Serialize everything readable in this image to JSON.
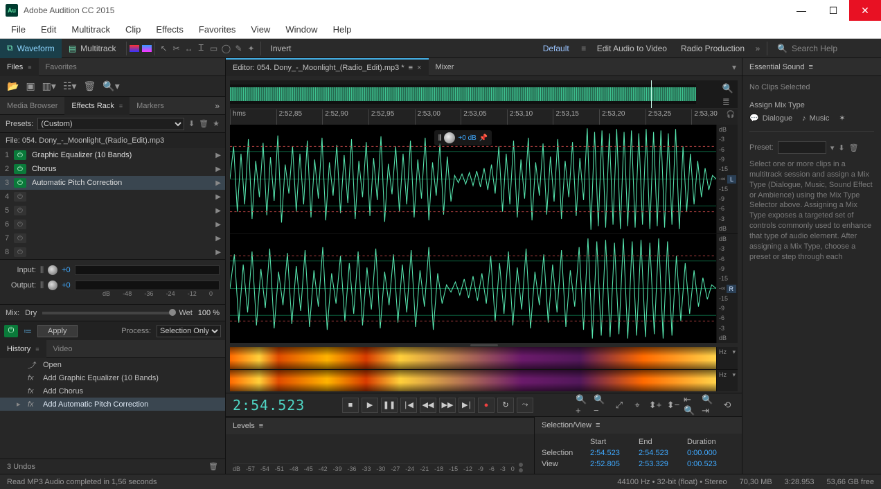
{
  "app": {
    "title": "Adobe Audition CC 2015",
    "icon_text": "Au"
  },
  "menu": [
    "File",
    "Edit",
    "Multitrack",
    "Clip",
    "Effects",
    "Favorites",
    "View",
    "Window",
    "Help"
  ],
  "toolbar": {
    "waveform": "Waveform",
    "multitrack": "Multitrack",
    "invert": "Invert",
    "workspace_default": "Default",
    "ws_edit_av": "Edit Audio to Video",
    "ws_radio": "Radio Production",
    "search_placeholder": "Search Help"
  },
  "left": {
    "tabs_files": "Files",
    "tabs_fav": "Favorites",
    "tabs_mb": "Media Browser",
    "tabs_fx": "Effects Rack",
    "tabs_markers": "Markers",
    "presets_label": "Presets:",
    "presets_value": "(Custom)",
    "file_label": "File: 054. Dony_-_Moonlight_(Radio_Edit).mp3",
    "fx": [
      {
        "n": "1",
        "on": true,
        "name": "Graphic Equalizer (10 Bands)"
      },
      {
        "n": "2",
        "on": true,
        "name": "Chorus"
      },
      {
        "n": "3",
        "on": true,
        "name": "Automatic Pitch Correction",
        "sel": true
      },
      {
        "n": "4",
        "on": false,
        "name": ""
      },
      {
        "n": "5",
        "on": false,
        "name": ""
      },
      {
        "n": "6",
        "on": false,
        "name": ""
      },
      {
        "n": "7",
        "on": false,
        "name": ""
      },
      {
        "n": "8",
        "on": false,
        "name": ""
      }
    ],
    "io_input": "Input:",
    "io_output": "Output:",
    "io_val": "+0",
    "db_ticks": [
      "dB",
      "-48",
      "-36",
      "-24",
      "-12",
      "0"
    ],
    "mix_label": "Mix:",
    "mix_dry": "Dry",
    "mix_wet": "Wet",
    "mix_pct": "100 %",
    "apply": "Apply",
    "process_label": "Process:",
    "process_value": "Selection Only",
    "hist_tab": "History",
    "video_tab": "Video",
    "history": [
      {
        "icon": "⤴",
        "label": "Open"
      },
      {
        "icon": "fx",
        "label": "Add Graphic Equalizer (10 Bands)"
      },
      {
        "icon": "fx",
        "label": "Add Chorus"
      },
      {
        "icon": "fx",
        "label": "Add Automatic Pitch Correction",
        "sel": true
      }
    ],
    "undos": "3 Undos"
  },
  "center": {
    "editor_tab": "Editor: 054. Dony_-_Moonlight_(Radio_Edit).mp3 *",
    "mixer_tab": "Mixer",
    "time_ticks": [
      "hms",
      "2:52,85",
      "2:52,90",
      "2:52,95",
      "2:53,00",
      "2:53,05",
      "2:53,10",
      "2:53,15",
      "2:53,20",
      "2:53,25",
      "2:53,30"
    ],
    "db_scale": [
      "dB",
      "-3",
      "-6",
      "-9",
      "-15",
      "-∞",
      "-15",
      "-9",
      "-6",
      "-3",
      "dB"
    ],
    "hud_val": "+0 dB",
    "hz": "Hz",
    "timecode": "2:54.523",
    "ch_l": "L",
    "ch_r": "R",
    "levels_label": "Levels",
    "level_ticks": [
      "dB",
      "-57",
      "-54",
      "-51",
      "-48",
      "-45",
      "-42",
      "-39",
      "-36",
      "-33",
      "-30",
      "-27",
      "-24",
      "-21",
      "-18",
      "-15",
      "-12",
      "-9",
      "-6",
      "-3",
      "0"
    ],
    "selview_label": "Selection/View",
    "sv_headers": {
      "start": "Start",
      "end": "End",
      "dur": "Duration"
    },
    "sv_rows": [
      {
        "label": "Selection",
        "start": "2:54.523",
        "end": "2:54.523",
        "dur": "0:00.000"
      },
      {
        "label": "View",
        "start": "2:52.805",
        "end": "2:53.329",
        "dur": "0:00.523"
      }
    ]
  },
  "right": {
    "header": "Essential Sound",
    "noclips": "No Clips Selected",
    "assign": "Assign Mix Type",
    "dialogue": "Dialogue",
    "music": "Music",
    "preset_label": "Preset:",
    "info": "Select one or more clips in a multitrack session and assign a Mix Type (Dialogue, Music, Sound Effect or Ambience) using the Mix Type Selector above. Assigning a Mix Type exposes a targeted set of controls commonly used to enhance that type of audio element.\nAfter assigning a Mix Type, choose a preset or step through each"
  },
  "status": {
    "left": "Read MP3 Audio completed in 1,56 seconds",
    "sr": "44100 Hz",
    "bit": "32-bit (float)",
    "ch": "Stereo",
    "size": "70,30 MB",
    "dur": "3:28.953",
    "free": "53,66 GB free"
  }
}
